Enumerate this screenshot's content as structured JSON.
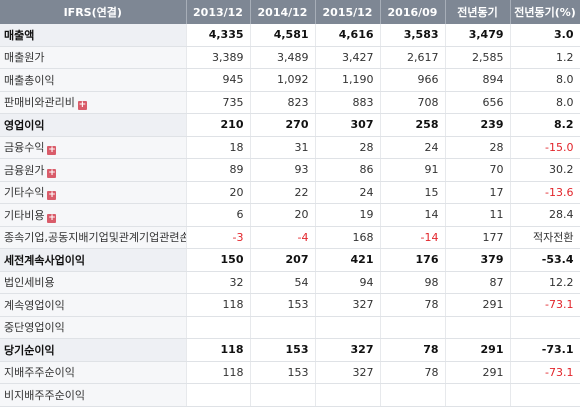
{
  "header": {
    "name_col": "IFRS(연결)",
    "columns": [
      "2013/12",
      "2014/12",
      "2015/12",
      "2016/09",
      "전년동기",
      "전년동기(%)"
    ]
  },
  "rows": [
    {
      "label": "매출액",
      "bold": true,
      "plus": false,
      "values": [
        "4,335",
        "4,581",
        "4,616",
        "3,583",
        "3,479",
        "3.0"
      ]
    },
    {
      "label": "매출원가",
      "bold": false,
      "plus": false,
      "values": [
        "3,389",
        "3,489",
        "3,427",
        "2,617",
        "2,585",
        "1.2"
      ]
    },
    {
      "label": "매출총이익",
      "bold": false,
      "plus": false,
      "values": [
        "945",
        "1,092",
        "1,190",
        "966",
        "894",
        "8.0"
      ]
    },
    {
      "label": "판매비와관리비",
      "bold": false,
      "plus": true,
      "values": [
        "735",
        "823",
        "883",
        "708",
        "656",
        "8.0"
      ]
    },
    {
      "label": "영업이익",
      "bold": true,
      "plus": false,
      "values": [
        "210",
        "270",
        "307",
        "258",
        "239",
        "8.2"
      ]
    },
    {
      "label": "금융수익",
      "bold": false,
      "plus": true,
      "values": [
        "18",
        "31",
        "28",
        "24",
        "28",
        "-15.0"
      ]
    },
    {
      "label": "금융원가",
      "bold": false,
      "plus": true,
      "values": [
        "89",
        "93",
        "86",
        "91",
        "70",
        "30.2"
      ]
    },
    {
      "label": "기타수익",
      "bold": false,
      "plus": true,
      "values": [
        "20",
        "22",
        "24",
        "15",
        "17",
        "-13.6"
      ]
    },
    {
      "label": "기타비용",
      "bold": false,
      "plus": true,
      "values": [
        "6",
        "20",
        "19",
        "14",
        "11",
        "28.4"
      ]
    },
    {
      "label": "종속기업,공동지배기업및관계기업관련손익",
      "bold": false,
      "plus": true,
      "values": [
        "-3",
        "-4",
        "168",
        "-14",
        "177",
        "적자전환"
      ]
    },
    {
      "label": "세전계속사업이익",
      "bold": true,
      "plus": false,
      "values": [
        "150",
        "207",
        "421",
        "176",
        "379",
        "-53.4"
      ]
    },
    {
      "label": "법인세비용",
      "bold": false,
      "plus": false,
      "values": [
        "32",
        "54",
        "94",
        "98",
        "87",
        "12.2"
      ]
    },
    {
      "label": "계속영업이익",
      "bold": false,
      "plus": false,
      "values": [
        "118",
        "153",
        "327",
        "78",
        "291",
        "-73.1"
      ]
    },
    {
      "label": "중단영업이익",
      "bold": false,
      "plus": false,
      "values": [
        "",
        "",
        "",
        "",
        "",
        ""
      ]
    },
    {
      "label": "당기순이익",
      "bold": true,
      "plus": false,
      "values": [
        "118",
        "153",
        "327",
        "78",
        "291",
        "-73.1"
      ]
    },
    {
      "label": "지배주주순이익",
      "bold": false,
      "plus": false,
      "values": [
        "118",
        "153",
        "327",
        "78",
        "291",
        "-73.1"
      ]
    },
    {
      "label": "비지배주주순이익",
      "bold": false,
      "plus": false,
      "values": [
        "",
        "",
        "",
        "",
        "",
        ""
      ]
    }
  ],
  "colors": {
    "negative": "#e2252b",
    "header_bg": "#7e8794",
    "plus_icon": "#d95c6a"
  }
}
